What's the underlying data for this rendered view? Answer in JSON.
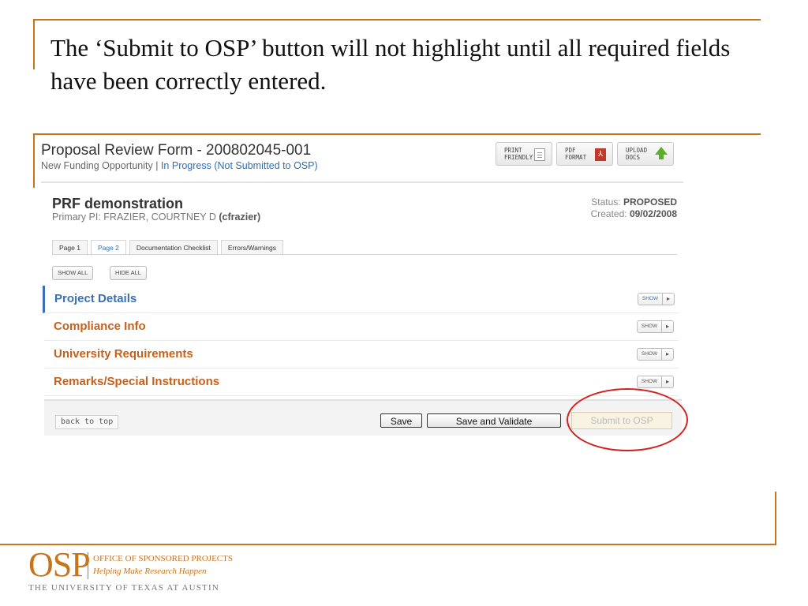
{
  "slide": {
    "instruction": "The ‘Submit to OSP’ button will not highlight until all required fields have been correctly entered."
  },
  "form": {
    "title": "Proposal Review Form - 200802045-001",
    "subtitle_prefix": "New Funding Opportunity |",
    "subtitle_status": "In Progress (Not Submitted to OSP)",
    "tools": [
      {
        "line1": "PRINT",
        "line2": "friendly",
        "icon": "document-icon"
      },
      {
        "line1": "PDF",
        "line2": "format",
        "icon": "pdf-icon"
      },
      {
        "line1": "UPLOAD",
        "line2": "Docs",
        "icon": "upload-arrow-icon"
      }
    ]
  },
  "proposal": {
    "title": "PRF demonstration",
    "pi_label": "Primary PI: FRAZIER, COURTNEY D",
    "pi_id": "(cfrazier)",
    "status_label": "Status:",
    "status_value": "PROPOSED",
    "created_label": "Created:",
    "created_value": "09/02/2008"
  },
  "tabs": [
    {
      "label": "Page 1",
      "active": false
    },
    {
      "label": "Page 2",
      "active": true
    },
    {
      "label": "Documentation Checklist",
      "active": false
    },
    {
      "label": "Errors/Warnings",
      "active": false
    }
  ],
  "controls": {
    "show_all": "SHOW ALL",
    "hide_all": "HIDE ALL"
  },
  "sections": [
    {
      "name": "Project Details",
      "show": "SHOW",
      "arrow": "▸"
    },
    {
      "name": "Compliance Info",
      "show": "SHOW",
      "arrow": "▸"
    },
    {
      "name": "University Requirements",
      "show": "SHOW",
      "arrow": "▸"
    },
    {
      "name": "Remarks/Special Instructions",
      "show": "SHOW",
      "arrow": "▸"
    }
  ],
  "footer": {
    "back_to_top": "back to top",
    "save": "Save",
    "save_validate": "Save and Validate",
    "submit": "Submit to OSP"
  },
  "logo": {
    "mark": "OSP",
    "line1": "OFFICE OF SPONSORED PROJECTS",
    "line2": "Helping Make Research Happen",
    "line3": "THE UNIVERSITY OF TEXAS AT AUSTIN"
  },
  "colors": {
    "accent_orange": "#c8741c",
    "section_orange": "#c8601a",
    "link_blue": "#2b6fb6",
    "annotation_red": "#d42020"
  }
}
